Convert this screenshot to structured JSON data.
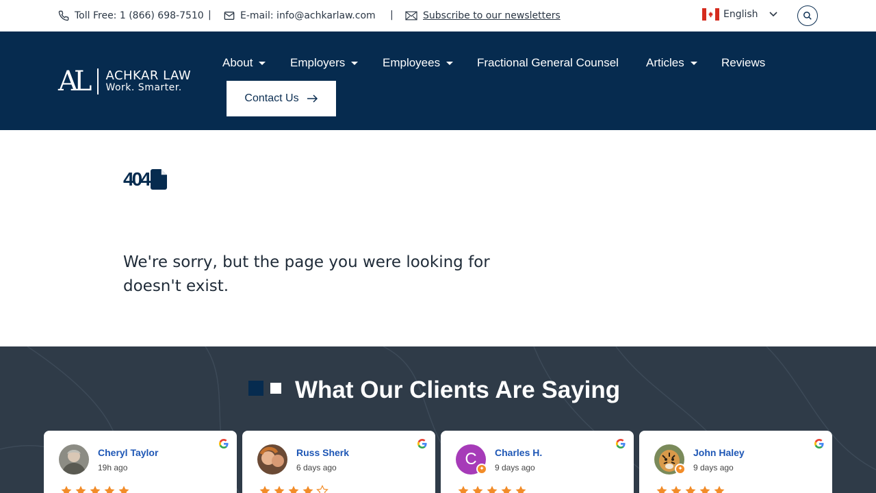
{
  "topbar": {
    "phone": "Toll Free: 1 (866) 698-7510",
    "separator": "|",
    "email": "E-mail: info@achkarlaw.com",
    "subscribe": "Subscribe to our newsletters",
    "language": "English"
  },
  "brand": {
    "mark": "AL",
    "name": "ACHKAR LAW",
    "tagline": "Work. Smarter."
  },
  "nav": {
    "items": [
      {
        "label": "About",
        "has_dropdown": true
      },
      {
        "label": "Employers",
        "has_dropdown": true
      },
      {
        "label": "Employees",
        "has_dropdown": true
      },
      {
        "label": "Fractional General Counsel",
        "has_dropdown": false
      },
      {
        "label": "Articles",
        "has_dropdown": true
      },
      {
        "label": "Reviews",
        "has_dropdown": false
      }
    ],
    "contact_label": "Contact Us"
  },
  "error": {
    "code": "404",
    "message": "We're sorry, but the page you were looking for doesn't exist."
  },
  "testimonials": {
    "title": "What Our Clients Are Saying",
    "reviews": [
      {
        "name": "Cheryl Taylor",
        "time": "19h ago",
        "rating": 5
      },
      {
        "name": "Russ Sherk",
        "time": "6 days ago",
        "rating": 4
      },
      {
        "name": "Charles H.",
        "time": "9 days ago",
        "rating": 5,
        "initial": "C"
      },
      {
        "name": "John Haley",
        "time": "9 days ago",
        "rating": 5
      }
    ]
  },
  "colors": {
    "navy": "#062b4f",
    "testimonial_bg": "#2f3b48",
    "star": "#f28c28",
    "reviewer_link": "#1d56b5"
  }
}
